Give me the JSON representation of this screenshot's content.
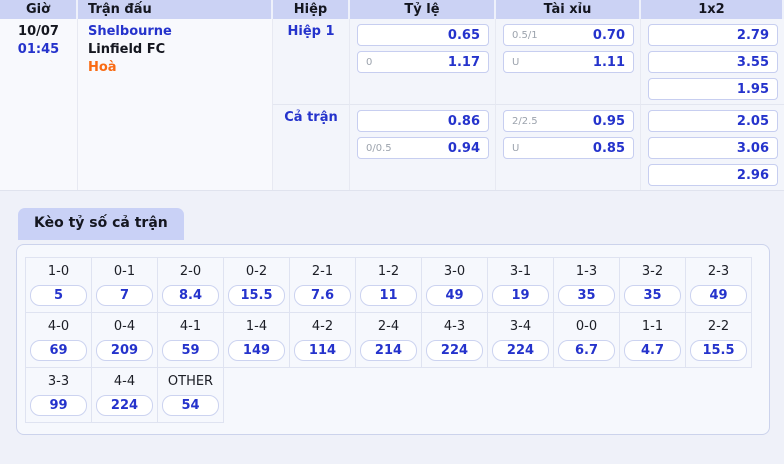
{
  "colors": {
    "accent_blue": "#2533cc",
    "draw_orange": "#f96b14",
    "header_bg": "#cbd2f4",
    "tab_bg": "#c9d1f6"
  },
  "odds_table": {
    "headers": {
      "time": "Giờ",
      "match": "Trận đấu",
      "half": "Hiệp",
      "handicap": "Tỷ lệ",
      "over_under": "Tài xỉu",
      "one_x_two": "1x2"
    },
    "match": {
      "date": "10/07",
      "kickoff": "01:45",
      "home": "Shelbourne",
      "away": "Linfield FC",
      "draw": "Hoà"
    },
    "sections": [
      {
        "label": "Hiệp 1",
        "handicap": [
          {
            "line": "",
            "odds": "0.65"
          },
          {
            "line": "0",
            "odds": "1.17"
          }
        ],
        "over_under": [
          {
            "line": "0.5/1",
            "odds": "0.70"
          },
          {
            "line": "U",
            "odds": "1.11"
          }
        ],
        "one_x_two": [
          "2.79",
          "3.55",
          "1.95"
        ]
      },
      {
        "label": "Cả trận",
        "handicap": [
          {
            "line": "",
            "odds": "0.86"
          },
          {
            "line": "0/0.5",
            "odds": "0.94"
          }
        ],
        "over_under": [
          {
            "line": "2/2.5",
            "odds": "0.95"
          },
          {
            "line": "U",
            "odds": "0.85"
          }
        ],
        "one_x_two": [
          "2.05",
          "3.06",
          "2.96"
        ]
      }
    ]
  },
  "score_section": {
    "tab_label": "Kèo tỷ số cả trận",
    "columns": 11,
    "rows": [
      [
        {
          "score": "1-0",
          "odds": "5"
        },
        {
          "score": "0-1",
          "odds": "7"
        },
        {
          "score": "2-0",
          "odds": "8.4"
        },
        {
          "score": "0-2",
          "odds": "15.5"
        },
        {
          "score": "2-1",
          "odds": "7.6"
        },
        {
          "score": "1-2",
          "odds": "11"
        },
        {
          "score": "3-0",
          "odds": "49"
        },
        {
          "score": "3-1",
          "odds": "19"
        },
        {
          "score": "1-3",
          "odds": "35"
        },
        {
          "score": "3-2",
          "odds": "35"
        },
        {
          "score": "2-3",
          "odds": "49"
        }
      ],
      [
        {
          "score": "4-0",
          "odds": "69"
        },
        {
          "score": "0-4",
          "odds": "209"
        },
        {
          "score": "4-1",
          "odds": "59"
        },
        {
          "score": "1-4",
          "odds": "149"
        },
        {
          "score": "4-2",
          "odds": "114"
        },
        {
          "score": "2-4",
          "odds": "214"
        },
        {
          "score": "4-3",
          "odds": "224"
        },
        {
          "score": "3-4",
          "odds": "224"
        },
        {
          "score": "0-0",
          "odds": "6.7"
        },
        {
          "score": "1-1",
          "odds": "4.7"
        },
        {
          "score": "2-2",
          "odds": "15.5"
        }
      ],
      [
        {
          "score": "3-3",
          "odds": "99"
        },
        {
          "score": "4-4",
          "odds": "224"
        },
        {
          "score": "OTHER",
          "odds": "54"
        }
      ]
    ]
  }
}
